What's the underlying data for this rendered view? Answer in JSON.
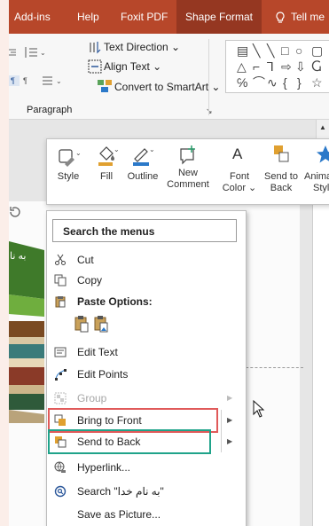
{
  "tabs": [
    "Add-ins",
    "Help",
    "Foxit PDF",
    "Shape Format"
  ],
  "tell_me": "Tell me",
  "ribbon": {
    "text_direction": "Text Direction",
    "align_text": "Align Text",
    "convert_smartart": "Convert to SmartArt",
    "group_label": "Paragraph"
  },
  "mini_toolbar": {
    "style": "Style",
    "fill": "Fill",
    "outline": "Outline",
    "new_comment": [
      "New",
      "Comment"
    ],
    "font_color": [
      "Font",
      "Color"
    ],
    "send_to_back": [
      "Send to",
      "Back"
    ],
    "animation_styles": [
      "Animati",
      "Styles"
    ]
  },
  "context_menu": {
    "search_placeholder": "Search the menus",
    "items": [
      {
        "label": "Cut",
        "icon": "scissors-icon",
        "enabled": true
      },
      {
        "label": "Copy",
        "icon": "copy-icon",
        "enabled": true
      },
      {
        "label": "Paste Options:",
        "icon": "paste-icon",
        "enabled": true
      },
      {
        "label": "Edit Text",
        "icon": "edit-text-icon",
        "enabled": true
      },
      {
        "label": "Edit Points",
        "icon": "edit-points-icon",
        "enabled": true
      },
      {
        "label": "Group",
        "icon": "group-icon",
        "enabled": false
      },
      {
        "label": "Bring to Front",
        "icon": "bring-front-icon",
        "enabled": true
      },
      {
        "label": "Send to Back",
        "icon": "send-back-icon",
        "enabled": true
      },
      {
        "label": "Hyperlink...",
        "icon": "hyperlink-icon",
        "enabled": true
      },
      {
        "label": "Search \"به نام خدا\"",
        "icon": "search-icon",
        "enabled": true
      },
      {
        "label": "Save as Picture...",
        "icon": "",
        "enabled": true
      }
    ]
  },
  "slide": {
    "partial_text": "به نا"
  },
  "colors": {
    "ribbon_tab": "#b7472a",
    "highlight_red": "#e05a5a",
    "highlight_green": "#1fa38a"
  }
}
